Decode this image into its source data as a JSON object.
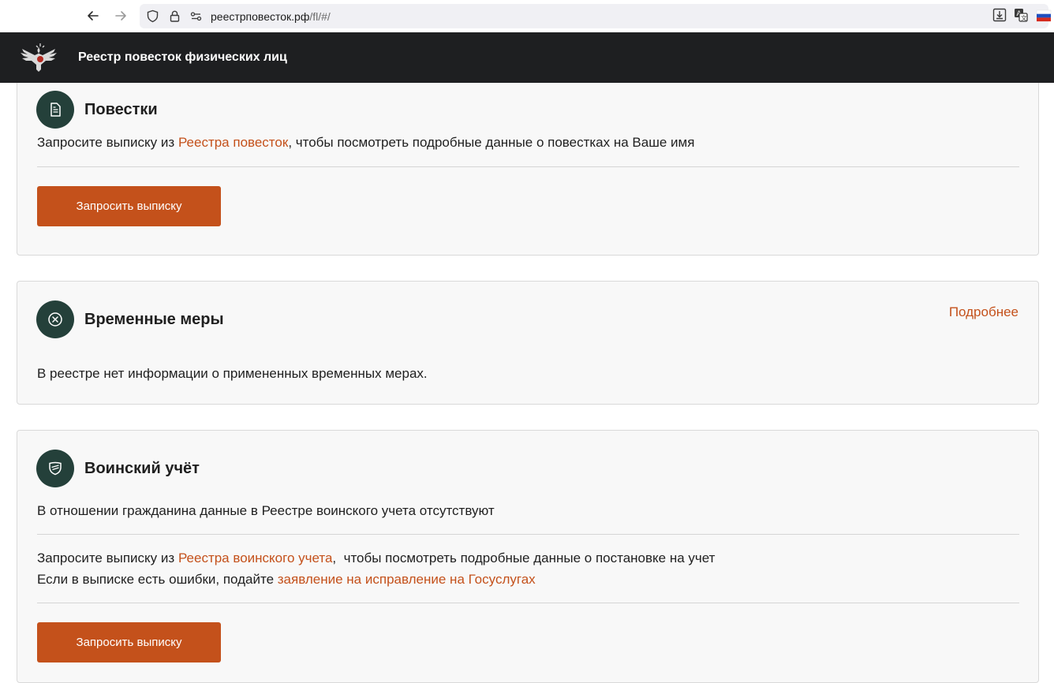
{
  "browser": {
    "url_host": "реестрповесток.рф",
    "url_path": "/fl/#/"
  },
  "header": {
    "title": "Реестр повесток физических лиц",
    "background": "#1e1f21"
  },
  "colors": {
    "accent": "#c4511b",
    "icon_circle": "#24403a",
    "card_bg": "#f8f8f8"
  },
  "cards": {
    "summons": {
      "title": "Повестки",
      "icon": "document-icon",
      "text_before": "Запросите выписку из ",
      "link": "Реестра повесток",
      "text_after": ", чтобы посмотреть подробные данные о повестках на Ваше имя",
      "button": "Запросить выписку"
    },
    "temp_measures": {
      "title": "Временные меры",
      "icon": "x-circle-icon",
      "more_link": "Подробнее",
      "text": "В реестре нет информации о примененных временных мерах."
    },
    "military_registration": {
      "title": "Воинский учёт",
      "icon": "shield-icon",
      "status_text": "В отношении гражданина данные в Реестре воинского учета отсутствуют",
      "line1_before": "Запросите выписку из ",
      "line1_link": "Реестра воинского учета",
      "line1_after": ",  чтобы посмотреть подробные данные о постановке на учет",
      "line2_before": "Если в выписке есть ошибки, подайте ",
      "line2_link": "заявление на исправление на Госуслугах",
      "button": "Запросить выписку"
    }
  }
}
